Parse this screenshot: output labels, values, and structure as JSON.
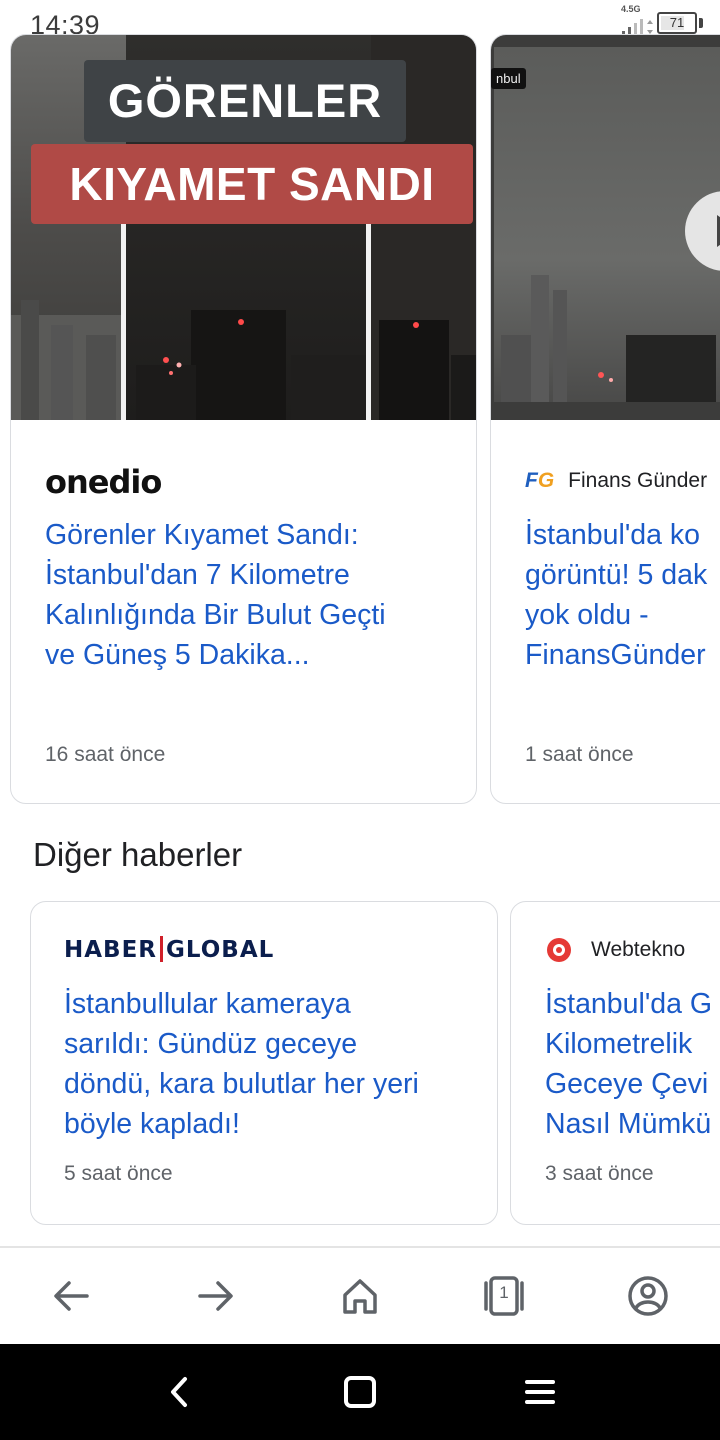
{
  "status_bar": {
    "time": "14:39",
    "network": "4.5G",
    "battery": "71",
    "battery_level": 0.71
  },
  "top_stories": [
    {
      "thumbnail_text_line1": "GÖRENLER",
      "thumbnail_text_line2": "KIYAMET SANDI",
      "source": "onedio",
      "headline": "Görenler Kıyamet Sandı:\nİstanbul'dan 7 Kilometre\nKalınlığında Bir Bulut Geçti\nve Güneş 5 Dakika...",
      "age": "16 saat önce"
    },
    {
      "thumbnail_tag": "nbul",
      "source_icon": "FG",
      "source": "Finans Günder",
      "headline": "İstanbul'da ko\ngörüntü! 5 dak\nyok oldu -\nFinansGünder",
      "age": "1 saat önce"
    }
  ],
  "section": {
    "title": "Diğer haberler"
  },
  "other_news": [
    {
      "source_logo_left": "HABER",
      "source_logo_right": "GLOBAL",
      "headline": "İstanbullular kameraya\nsarıldı: Gündüz geceye\ndöndü, kara bulutlar her yeri\nböyle kapladı!",
      "age": "5 saat önce"
    },
    {
      "source": "Webtekno",
      "headline": "İstanbul'da G\nKilometrelik\nGeceye Çevi\nNasıl Mümkü",
      "age": "3 saat önce"
    }
  ],
  "toolbar": {
    "back": "back-arrow-icon",
    "forward": "forward-arrow-icon",
    "home": "home-icon",
    "tabs_count": "1",
    "account": "account-icon"
  },
  "nav_bar": {
    "back": "nav-back-icon",
    "home": "nav-home-icon",
    "menu": "nav-menu-icon"
  },
  "colors": {
    "headline": "#1a5ac8",
    "card_border": "#dadce0",
    "overlay_red": "#b04a46",
    "overlay_gray": "#3f4346"
  }
}
